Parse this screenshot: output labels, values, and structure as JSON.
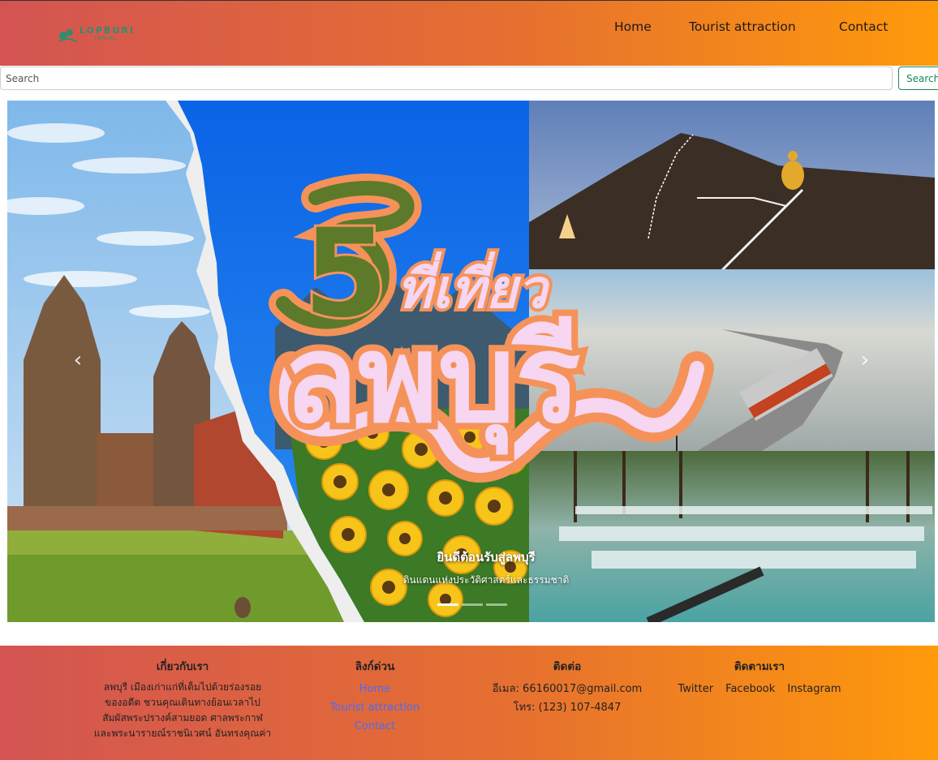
{
  "header": {
    "logo": {
      "text": "LOPBURI",
      "sub": "TRAVEL",
      "icon": "monkey-logo-icon"
    },
    "nav": [
      "Home",
      "Tourist attraction",
      "Contact"
    ]
  },
  "search": {
    "placeholder": "Search",
    "button_label": "Search"
  },
  "carousel": {
    "banner_number": "5",
    "banner_line1": "ที่เที่ยว",
    "banner_line2": "ลพบุรี",
    "caption_title": "ยินดีต้อนรับสู่ลพบุรี",
    "caption_subtitle": "ดินแดนแห่งประวัติศาสตร์และธรรมชาติ",
    "prev_icon": "chevron-left-icon",
    "next_icon": "chevron-right-icon",
    "slides_count": 3,
    "active_slide": 1
  },
  "footer": {
    "about": {
      "heading": "เกี่ยวกับเรา",
      "lines": [
        "ลพบุรี เมืองเก่าแก่ที่เต็มไปด้วยร่องรอย",
        "ของอดีต ชวนคุณเดินทางย้อนเวลาไป",
        "สัมผัสพระปรางค์สามยอด ศาลพระกาฬ",
        "และพระนารายณ์ราชนิเวศน์ อันทรงคุณค่า"
      ]
    },
    "links": {
      "heading": "ลิงก์ด่วน",
      "items": [
        "Home",
        "Tourist attraction",
        "Contact"
      ]
    },
    "contact": {
      "heading": "ติดต่อ",
      "email": "อีเมล: 66160017@gmail.com",
      "phone": "โทร: (123) 107-4847"
    },
    "follow": {
      "heading": "ติดตามเรา",
      "items": [
        "Twitter",
        "Facebook",
        "Instagram"
      ]
    }
  },
  "colors": {
    "header_gradient_start": "#d35452",
    "header_gradient_end": "#ff9a0a",
    "search_button": "#198754",
    "footer_link": "#4a6cf7",
    "banner_orange": "#f5925a",
    "banner_green": "#5c7a2a",
    "banner_pink": "#f6d6f0"
  }
}
